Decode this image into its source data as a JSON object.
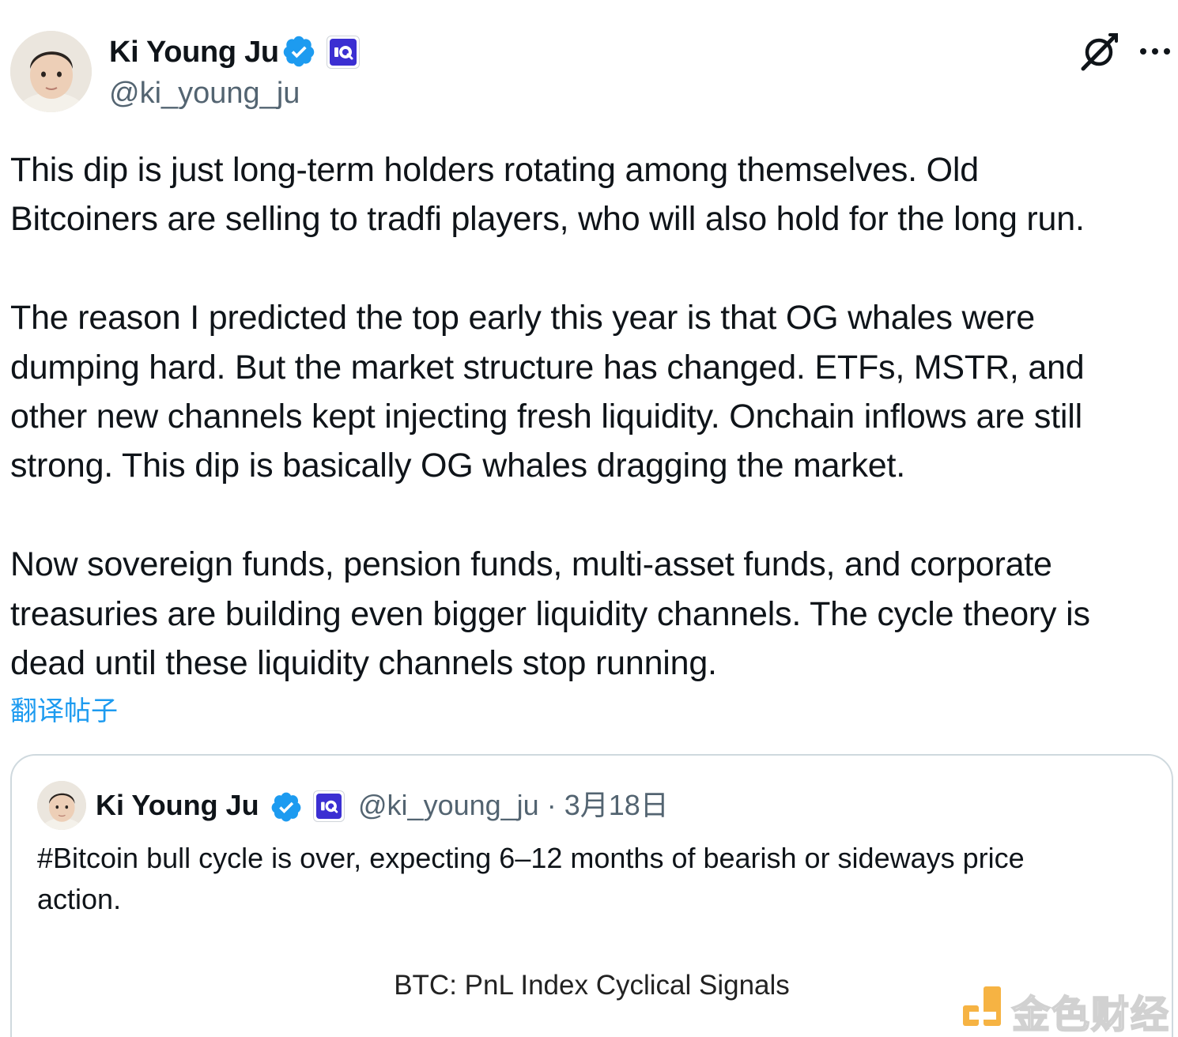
{
  "tweet": {
    "author": {
      "display_name": "Ki Young Ju",
      "handle": "@ki_young_ju",
      "verified": true,
      "affiliation_badge": "cryptoquant-logo"
    },
    "header_icons": [
      "grok-icon",
      "more-icon"
    ],
    "paragraphs": [
      [
        "This dip is just long-term holders rotating among themselves. Old",
        "Bitcoiners are selling to tradfi players, who will also hold for the long run."
      ],
      [
        "The reason I predicted the top early this year is that OG whales were",
        "dumping hard. But the market structure has changed. ETFs, MSTR, and",
        "other new channels kept injecting fresh liquidity. Onchain inflows are still",
        "strong. This dip is basically OG whales dragging the market."
      ],
      [
        "Now sovereign funds, pension funds, multi-asset funds, and corporate",
        "treasuries are building even bigger liquidity channels. The cycle theory is",
        "dead until these liquidity channels stop running."
      ]
    ],
    "translate_label": "翻译帖子"
  },
  "quote": {
    "display_name": "Ki Young Ju",
    "handle": "@ki_young_ju",
    "separator": "·",
    "date": "3月18日",
    "text_lines": [
      "#Bitcoin bull cycle is over, expecting 6–12 months of bearish or sideways price",
      "action."
    ],
    "chart_title": "BTC: PnL Index Cyclical Signals"
  },
  "watermark": {
    "text": "金色财经"
  },
  "colors": {
    "text": "#0f1419",
    "secondary": "#536471",
    "link": "#1d9bf0",
    "verified": "#1d9bf0",
    "border": "#cfd9de",
    "affiliation_bg": "#3b2fd2",
    "watermark_orange": "#f5a623"
  }
}
